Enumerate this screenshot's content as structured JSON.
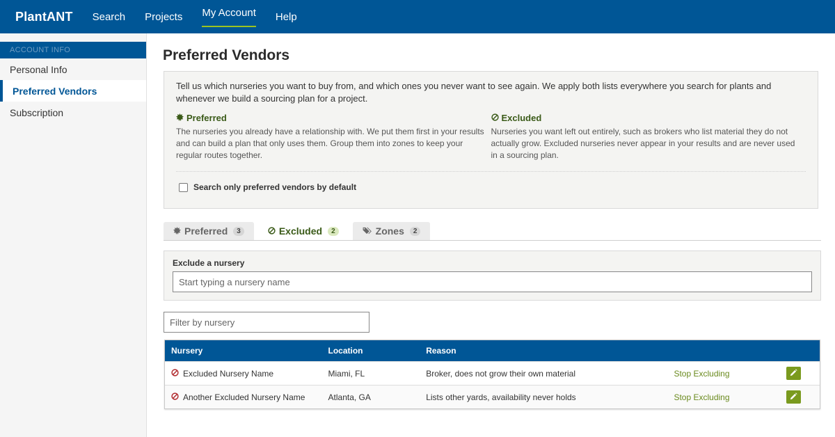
{
  "nav": {
    "brand": "PlantANT",
    "links": [
      "Search",
      "Projects",
      "My Account",
      "Help"
    ],
    "active": "My Account"
  },
  "sidebar": {
    "header": "ACCOUNT INFO",
    "items": [
      "Personal Info",
      "Preferred Vendors",
      "Subscription"
    ],
    "active": "Preferred Vendors"
  },
  "page": {
    "title": "Preferred Vendors",
    "intro": "Tell us which nurseries you want to buy from, and which ones you never want to see again. We apply both lists everywhere you search for plants and whenever we build a sourcing plan for a project.",
    "preferred": {
      "title": "Preferred",
      "text": "The nurseries you already have a relationship with. We put them first in your results and can build a plan that only uses them. Group them into zones to keep your regular routes together."
    },
    "excluded": {
      "title": "Excluded",
      "text": "Nurseries you want left out entirely, such as brokers who list material they do not actually grow. Excluded nurseries never appear in your results and are never used in a sourcing plan."
    },
    "checkbox_label": "Search only preferred vendors by default"
  },
  "tabs": [
    {
      "label": "Preferred",
      "count": "3"
    },
    {
      "label": "Excluded",
      "count": "2"
    },
    {
      "label": "Zones",
      "count": "2"
    }
  ],
  "active_tab": "Excluded",
  "exclude": {
    "label": "Exclude a nursery",
    "placeholder": "Start typing a nursery name"
  },
  "filter": {
    "placeholder": "Filter by nursery"
  },
  "table": {
    "headers": [
      "Nursery",
      "Location",
      "Reason"
    ],
    "rows": [
      {
        "nursery": "Excluded Nursery Name",
        "location": "Miami, FL",
        "reason": "Broker, does not grow their own material",
        "action": "Stop Excluding"
      },
      {
        "nursery": "Another Excluded Nursery Name",
        "location": "Atlanta, GA",
        "reason": "Lists other yards, availability never holds",
        "action": "Stop Excluding"
      }
    ]
  },
  "colors": {
    "primary": "#005696",
    "accent_green": "#7a9a1e",
    "excluded_red": "#b0282c"
  },
  "icons": {
    "preferred": "star-burst-icon",
    "excluded": "ban-icon",
    "zones": "tags-icon",
    "edit": "pencil-icon"
  }
}
